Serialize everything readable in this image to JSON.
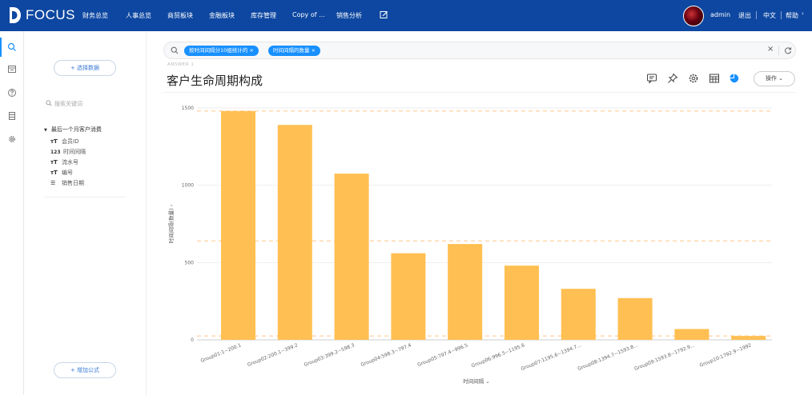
{
  "app": {
    "logo_text": "FOCUS",
    "nav": [
      "财务总览",
      "人事总览",
      "商贸板块",
      "金融板块",
      "库存管理",
      "Copy of ...",
      "销售分析"
    ],
    "user": "admin",
    "links": [
      "退出",
      "中文",
      "帮助"
    ]
  },
  "sidebar_icons": [
    "search-icon",
    "board-icon",
    "help-icon",
    "database-icon",
    "settings-icon"
  ],
  "left_panel": {
    "select_data_btn": "+ 选择数据",
    "search_placeholder": "搜索关键词",
    "table_name": "最后一个月客户消费",
    "fields": [
      {
        "type": "T",
        "name": "会员ID"
      },
      {
        "type": "123",
        "name": "时间间隔"
      },
      {
        "type": "T",
        "name": "流水号"
      },
      {
        "type": "T",
        "name": "编号"
      },
      {
        "type": "date",
        "name": "销售日期"
      }
    ],
    "add_formula_btn": "+ 增加公式"
  },
  "query": {
    "tags": [
      "按时间间隔分10组统计的",
      "时间间隔的数量"
    ]
  },
  "answer_label": "ANSWER 1",
  "page_title": "客户生命周期构成",
  "toolbar": {
    "icons": [
      "comment-icon",
      "pin-icon",
      "settings-icon",
      "table-icon",
      "pie-chart-icon"
    ],
    "op_label": "操作"
  },
  "chart_data": {
    "type": "bar",
    "color": "#ffbf52",
    "categories": [
      "Group01:1~200.1",
      "Group02:200.1~399.2",
      "Group03:399.2~598.3",
      "Group04:598.3~797.4",
      "Group05:797.4~996.5",
      "Group06:996.5~1195.6",
      "Group07:1195.6~1394.7...",
      "Group08:1394.7~1593.8...",
      "Group09:1593.8~1792.9...",
      "Group10:1792.9~1992"
    ],
    "values": [
      1480,
      1390,
      1075,
      560,
      620,
      480,
      330,
      270,
      70,
      25
    ],
    "ylim": [
      0,
      1500
    ],
    "yticks": [
      0,
      500,
      1000,
      1500
    ],
    "xlabel": "时间间隔",
    "ylabel": "时间间隔(数量)",
    "reference_lines": [
      1480,
      640,
      25
    ]
  }
}
